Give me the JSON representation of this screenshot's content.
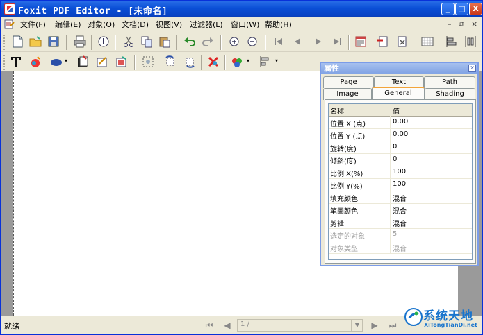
{
  "window": {
    "title": "Foxit PDF Editor - [未命名]"
  },
  "title_buttons": [
    "_",
    "□",
    "X"
  ],
  "menu": {
    "items": [
      "文件(F)",
      "编辑(E)",
      "对象(O)",
      "文档(D)",
      "视图(V)",
      "过滤器(L)",
      "窗口(W)",
      "帮助(H)"
    ],
    "mdi_buttons": [
      "–",
      "⧉",
      "×"
    ]
  },
  "icons": {
    "toolbar1": [
      "new-document-icon",
      "open-folder-icon",
      "save-icon",
      "print-icon",
      "info-icon",
      "cut-icon",
      "copy-icon",
      "paste-icon",
      "undo-icon",
      "redo-icon",
      "zoom-in-icon",
      "zoom-out-icon",
      "first-page-icon",
      "previous-page-icon",
      "next-page-icon",
      "last-page-icon",
      "properties-icon",
      "insert-page-icon",
      "delete-page-icon",
      "grid-icon",
      "align-icon",
      "distribute-icon"
    ],
    "toolbar2": [
      "text-tool-icon",
      "color-tool-icon",
      "ellipse-tool-icon",
      "image-tool-icon",
      "edit-object-icon",
      "edit-page-icon",
      "select-icon",
      "rotate-left-icon",
      "rotate-right-icon",
      "delete-object-icon",
      "fill-color-icon",
      "align-left-icon"
    ]
  },
  "panel": {
    "title": "属性",
    "close": "x",
    "tabs_back": [
      "Page",
      "Text",
      "Path"
    ],
    "tabs_front": [
      "Image",
      "General",
      "Shading"
    ],
    "active_tab": "General",
    "header": {
      "name": "名称",
      "value": "值"
    },
    "rows": [
      {
        "name": "位置 X (点)",
        "value": "0.00",
        "disabled": false
      },
      {
        "name": "位置 Y (点)",
        "value": "0.00",
        "disabled": false
      },
      {
        "name": "旋转(度)",
        "value": "0",
        "disabled": false
      },
      {
        "name": "倾斜(度)",
        "value": "0",
        "disabled": false
      },
      {
        "name": "比例 X(%)",
        "value": "100",
        "disabled": false
      },
      {
        "name": "比例 Y(%)",
        "value": "100",
        "disabled": false
      },
      {
        "name": "填充颜色",
        "value": "混合",
        "disabled": false
      },
      {
        "name": "笔画颜色",
        "value": "混合",
        "disabled": false
      },
      {
        "name": "剪辑",
        "value": "混合",
        "disabled": false
      },
      {
        "name": "选定的对象",
        "value": "5",
        "disabled": true
      },
      {
        "name": "对象类型",
        "value": "混合",
        "disabled": true
      }
    ]
  },
  "status": {
    "text": "就绪",
    "page_indicator": "1 / ",
    "nav": [
      "⏮",
      "◀",
      "▶",
      "⏭"
    ]
  },
  "watermark": {
    "text": "系统天地",
    "url": "XiTongTianDi.net"
  },
  "colors": {
    "titlebar": "#0a4fd6",
    "panel_border": "#7b9ce8",
    "tab_highlight": "#f2a43a",
    "watermark": "#1874cd"
  }
}
